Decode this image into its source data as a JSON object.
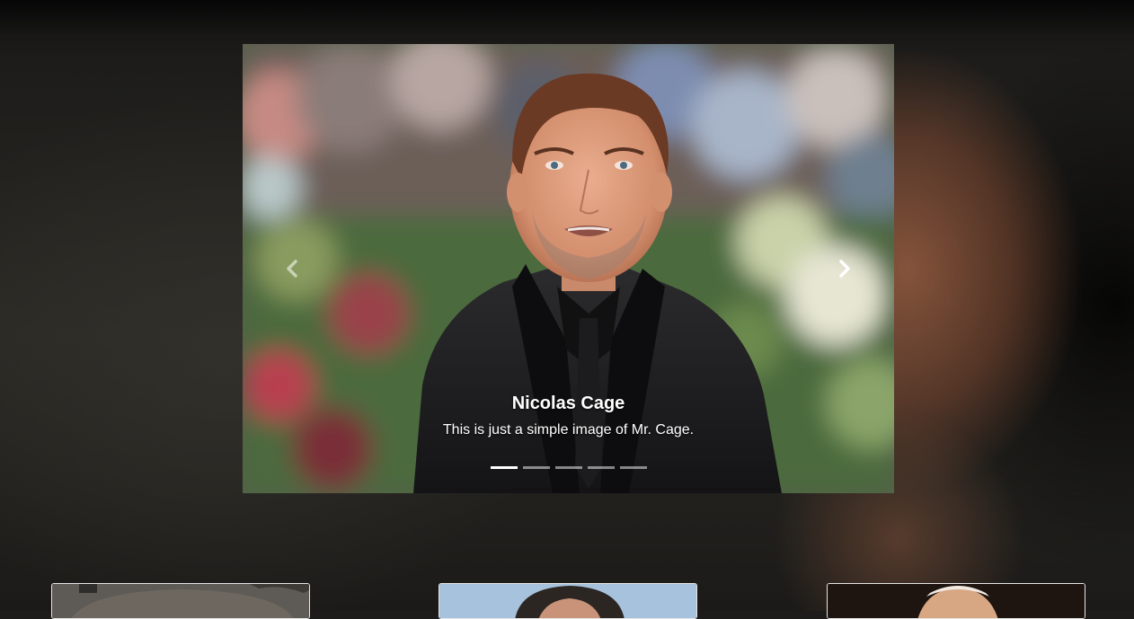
{
  "carousel": {
    "active_index": 0,
    "slide_count": 5,
    "caption": {
      "title": "Nicolas Cage",
      "text": "This is just a simple image of Mr. Cage."
    },
    "prev_icon": "chevron-left-icon",
    "next_icon": "chevron-right-icon"
  },
  "thumbnails": [
    {
      "name": "thumbnail-1"
    },
    {
      "name": "thumbnail-2"
    },
    {
      "name": "thumbnail-3"
    }
  ]
}
